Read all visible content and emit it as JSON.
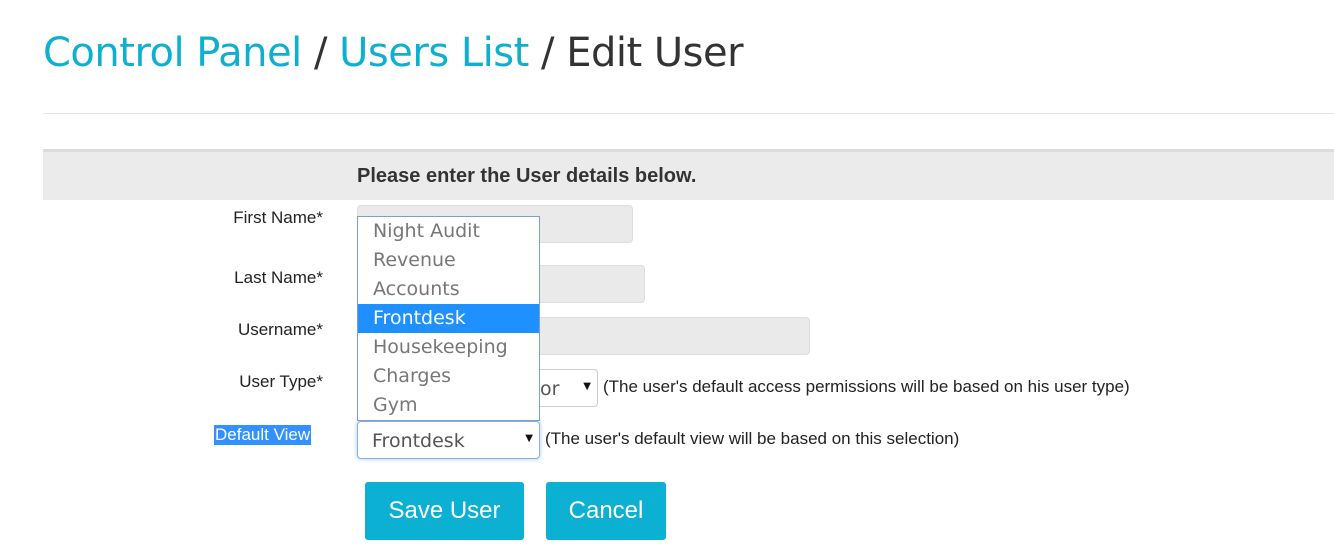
{
  "breadcrumb": {
    "items": [
      "Control Panel",
      "Users List"
    ],
    "current": "Edit User",
    "separator": "/"
  },
  "form": {
    "heading": "Please enter the User details below.",
    "first_name_label": "First Name*",
    "last_name_label": "Last Name*",
    "username_label": "Username*",
    "user_type_label": "User Type*",
    "user_type_visible_value": "or",
    "user_type_hint": "(The user's default access permissions will be based on his user type)",
    "default_view_label": "Default View",
    "default_view_value": "Frontdesk",
    "default_view_hint": "(The user's default view will be based on this selection)",
    "dropdown_options": [
      "Night Audit",
      "Revenue",
      "Accounts",
      "Frontdesk",
      "Housekeeping",
      "Charges",
      "Gym"
    ],
    "dropdown_highlighted": "Frontdesk"
  },
  "buttons": {
    "save": "Save User",
    "cancel": "Cancel"
  },
  "colors": {
    "accent": "#0cb0d3",
    "highlight": "#1e90ff"
  }
}
